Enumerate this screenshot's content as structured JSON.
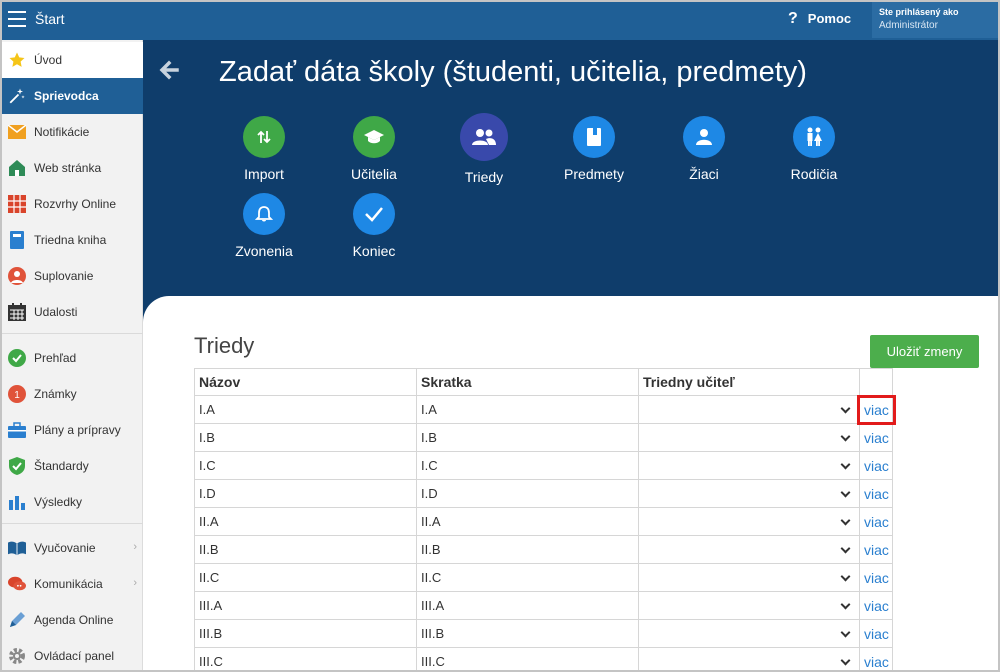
{
  "topbar": {
    "title": "Štart",
    "help_label": "Pomoc",
    "user_line1": "Ste prihlásený ako",
    "user_line2": "Administrátor"
  },
  "sidebar": {
    "items": [
      {
        "label": "Úvod",
        "icon": "star-icon"
      },
      {
        "label": "Sprievodca",
        "icon": "magic-wand-icon"
      },
      {
        "label": "Notifikácie",
        "icon": "envelope-icon"
      },
      {
        "label": "Web stránka",
        "icon": "house-icon"
      },
      {
        "label": "Rozvrhy Online",
        "icon": "timetable-icon"
      },
      {
        "label": "Triedna kniha",
        "icon": "book-icon"
      },
      {
        "label": "Suplovanie",
        "icon": "person-icon"
      },
      {
        "label": "Udalosti",
        "icon": "calendar-icon"
      },
      {
        "label": "Prehľad",
        "icon": "check-circle-icon"
      },
      {
        "label": "Známky",
        "icon": "grades-icon"
      },
      {
        "label": "Plány a prípravy",
        "icon": "briefcase-icon"
      },
      {
        "label": "Štandardy",
        "icon": "shield-check-icon"
      },
      {
        "label": "Výsledky",
        "icon": "bar-chart-icon"
      },
      {
        "label": "Vyučovanie",
        "icon": "open-book-icon"
      },
      {
        "label": "Komunikácia",
        "icon": "chat-icon"
      },
      {
        "label": "Agenda Online",
        "icon": "pen-icon"
      },
      {
        "label": "Ovládací panel",
        "icon": "gear-icon"
      }
    ]
  },
  "page": {
    "title": "Zadať dáta školy (študenti, učitelia, predmety)"
  },
  "wizard": [
    {
      "label": "Import",
      "icon": "import-arrows-icon"
    },
    {
      "label": "Učitelia",
      "icon": "graduation-cap-icon"
    },
    {
      "label": "Triedy",
      "icon": "people-icon"
    },
    {
      "label": "Predmety",
      "icon": "notebook-icon"
    },
    {
      "label": "Žiaci",
      "icon": "student-icon"
    },
    {
      "label": "Rodičia",
      "icon": "parents-icon"
    },
    {
      "label": "Zvonenia",
      "icon": "bell-icon"
    },
    {
      "label": "Koniec",
      "icon": "check-icon"
    }
  ],
  "classes": {
    "title": "Triedy",
    "save_label": "Uložiť zmeny",
    "headers": [
      "Názov",
      "Skratka",
      "Triedny učiteľ"
    ],
    "more_label": "viac",
    "rows": [
      {
        "name": "I.A",
        "short": "I.A"
      },
      {
        "name": "I.B",
        "short": "I.B"
      },
      {
        "name": "I.C",
        "short": "I.C"
      },
      {
        "name": "I.D",
        "short": "I.D"
      },
      {
        "name": "II.A",
        "short": "II.A"
      },
      {
        "name": "II.B",
        "short": "II.B"
      },
      {
        "name": "II.C",
        "short": "II.C"
      },
      {
        "name": "III.A",
        "short": "III.A"
      },
      {
        "name": "III.B",
        "short": "III.B"
      },
      {
        "name": "III.C",
        "short": "III.C"
      }
    ]
  }
}
